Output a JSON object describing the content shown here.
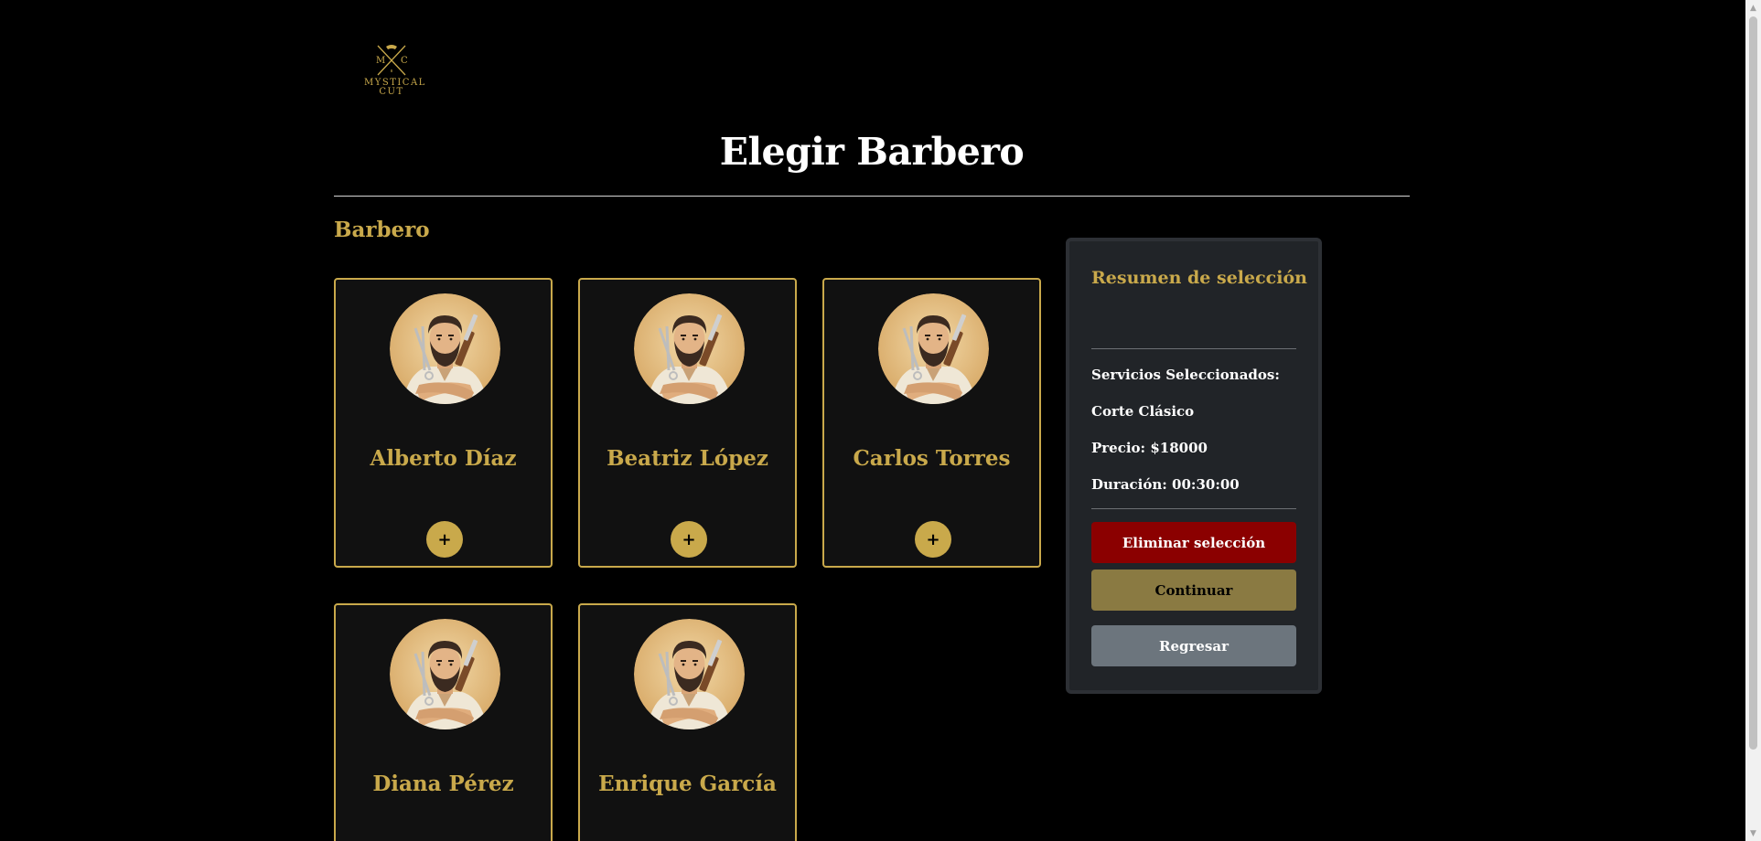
{
  "logo": {
    "monogram_left": "M",
    "monogram_right": "C",
    "brand": "MYSTICAL CUT"
  },
  "page": {
    "title": "Elegir Barbero",
    "section_label": "Barbero"
  },
  "barbers": [
    {
      "name": "Alberto Díaz",
      "add_label": "+"
    },
    {
      "name": "Beatriz López",
      "add_label": "+"
    },
    {
      "name": "Carlos Torres",
      "add_label": "+"
    },
    {
      "name": "Diana Pérez",
      "add_label": "+"
    },
    {
      "name": "Enrique García",
      "add_label": "+"
    }
  ],
  "summary": {
    "title": "Resumen de selección",
    "services_label": "Servicios Seleccionados:",
    "service": "Corte Clásico",
    "price": "Precio: $18000",
    "duration": "Duración: 00:30:00",
    "remove_button": "Eliminar selección",
    "continue_button": "Continuar",
    "back_button": "Regresar"
  },
  "colors": {
    "background": "#000000",
    "accent_gold": "#c9a94b",
    "card_bg": "#111111",
    "panel_bg": "#212428",
    "danger": "#8b0000",
    "muted_gold": "#8a7a42",
    "secondary": "#6c757d"
  },
  "icons": {
    "add": "plus-icon",
    "avatar": "barber-avatar-icon",
    "logo": "crossed-scissors-logo-icon"
  }
}
